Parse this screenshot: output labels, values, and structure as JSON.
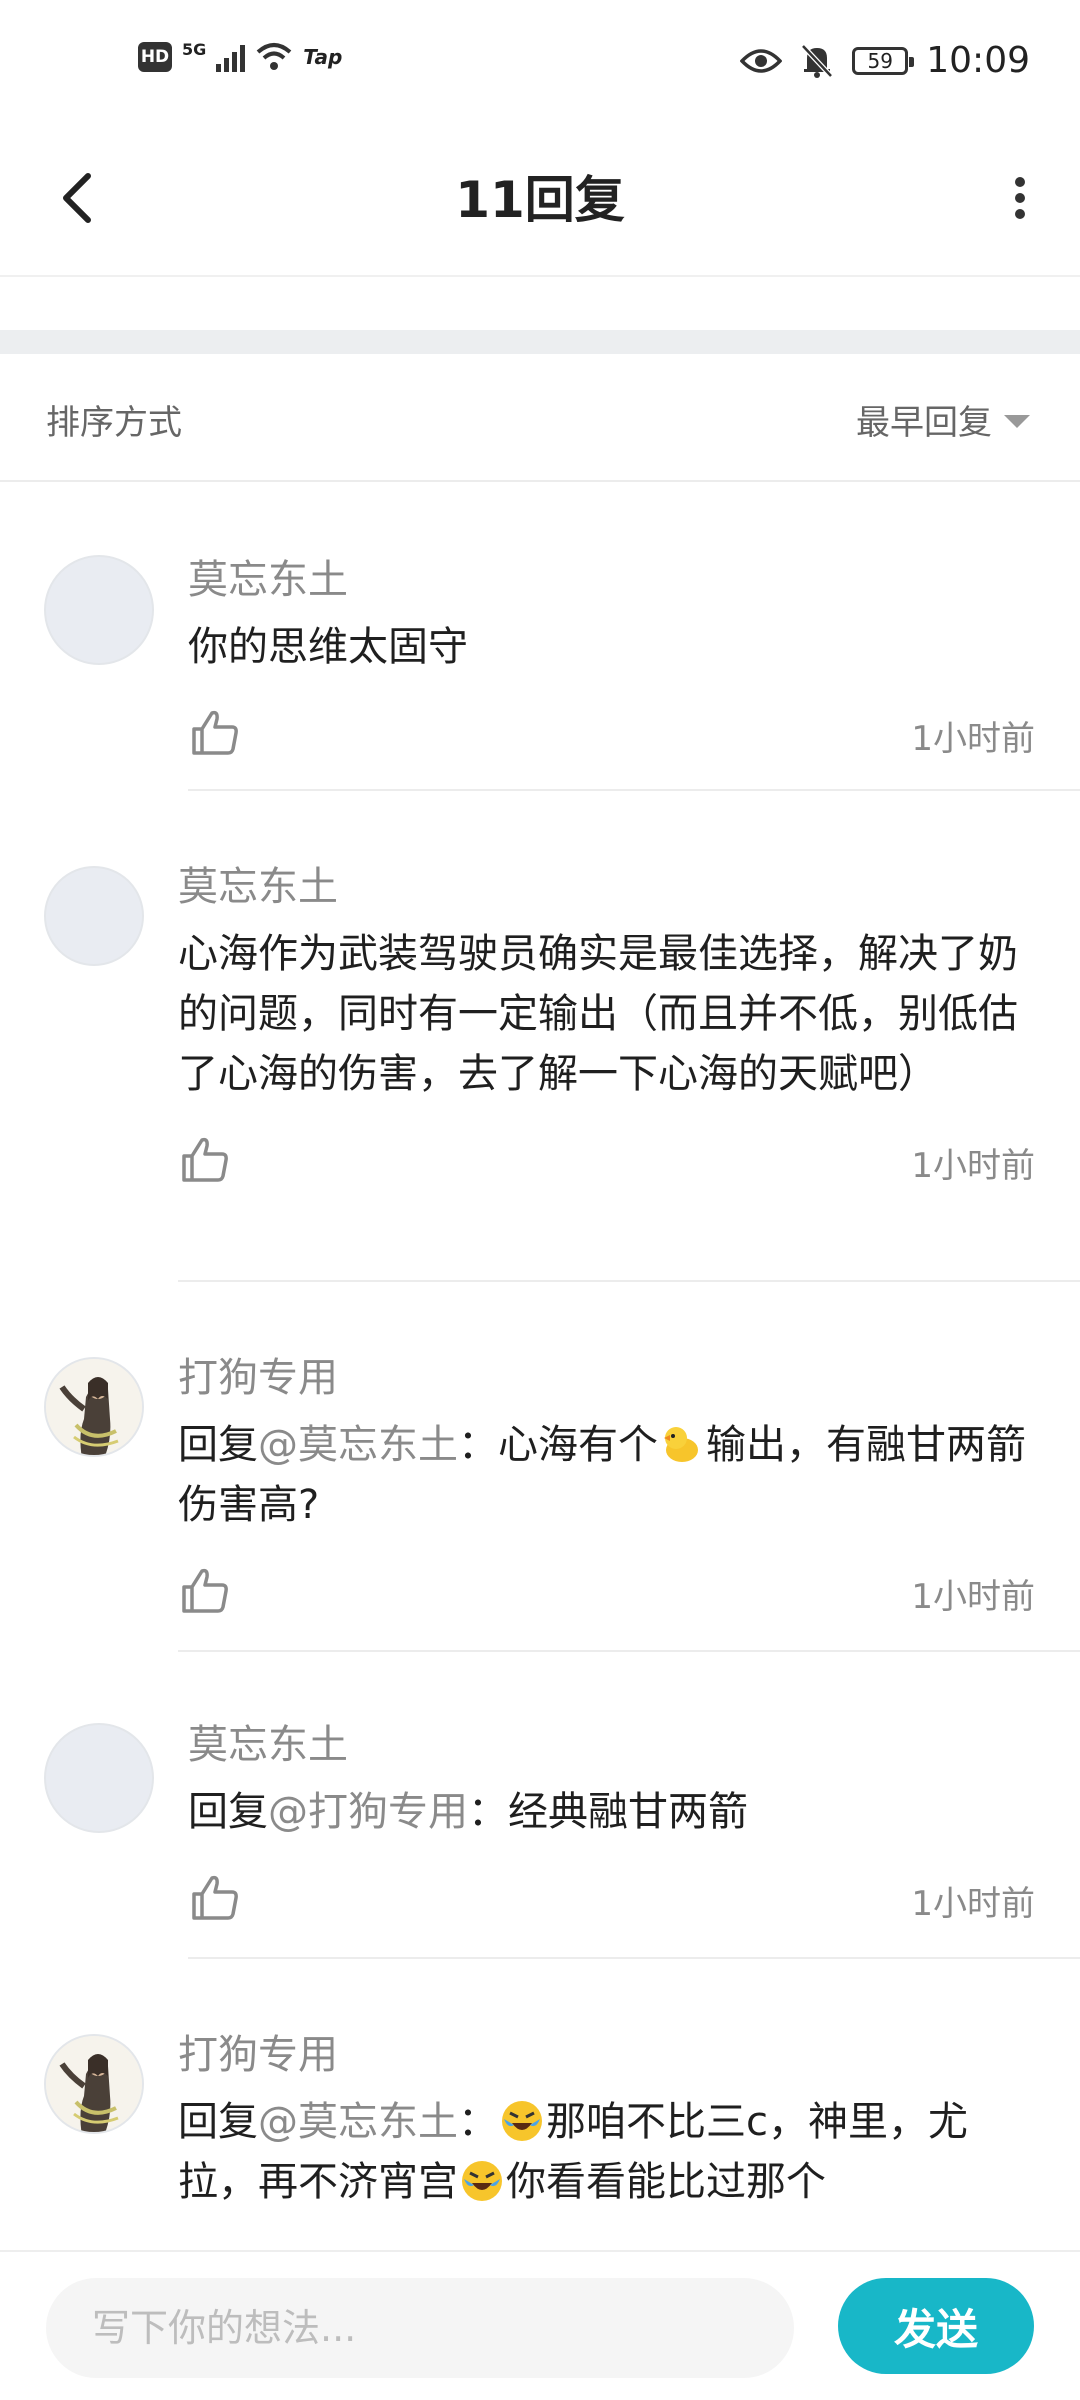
{
  "status_bar": {
    "hd": "HD",
    "network": "5G",
    "tap": "Tap",
    "battery": "59",
    "time": "10:09"
  },
  "header": {
    "title": "11回复"
  },
  "sort": {
    "label": "排序方式",
    "selected": "最早回复"
  },
  "comments": [
    {
      "user": "莫忘东土",
      "text": "你的思维太固守",
      "time": "1小时前"
    },
    {
      "user": "莫忘东土",
      "text": "心海作为武装驾驶员确实是最佳选择，解决了奶的问题，同时有一定输出（而且并不低，别低估了心海的伤害，去了解一下心海的天赋吧）",
      "time": "1小时前"
    },
    {
      "user": "打狗专用",
      "reply_prefix": "回复",
      "reply_to": "@莫忘东土",
      "text_a": "：心海有个",
      "text_b": "输出，有融甘两箭伤害高?",
      "time": "1小时前"
    },
    {
      "user": "莫忘东土",
      "reply_prefix": "回复",
      "reply_to": "@打狗专用",
      "text": "：经典融甘两箭",
      "time": "1小时前"
    },
    {
      "user": "打狗专用",
      "reply_prefix": "回复",
      "reply_to": "@莫忘东土",
      "text_a": "：",
      "text_b": "那咱不比三c，神里，尤拉，再不济宵宫",
      "text_c": "你看看能比过那个"
    }
  ],
  "composer": {
    "placeholder": "写下你的想法...",
    "send_label": "发送"
  },
  "colors": {
    "accent": "#18b7c8",
    "muted": "#8a8a8a"
  }
}
